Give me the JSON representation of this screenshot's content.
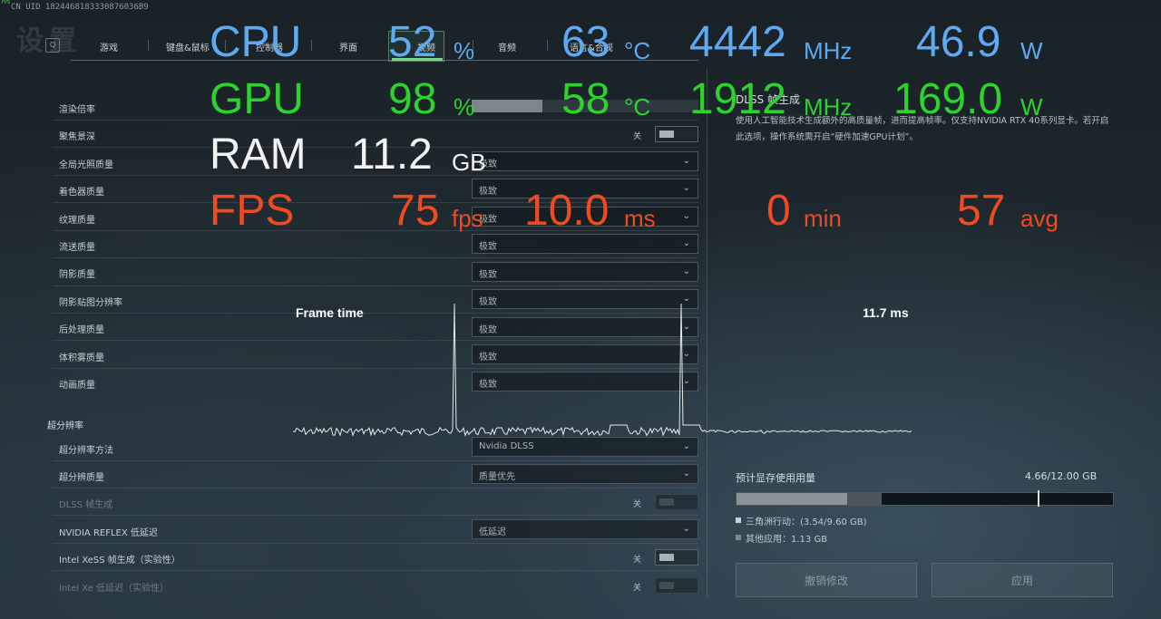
{
  "topbar": {
    "uid": "CN UID 1824468183330876036B9",
    "fps_tiny": "FPS",
    "bg_title": "设置"
  },
  "tabs": [
    {
      "label": "游戏"
    },
    {
      "label": "键盘&鼠标"
    },
    {
      "label": "控制器"
    },
    {
      "label": "界面"
    },
    {
      "label": "视频"
    },
    {
      "label": "音频"
    },
    {
      "label": "语言&合规"
    }
  ],
  "tab_q": "Q",
  "settings": {
    "rows": [
      {
        "label": "渲染倍率",
        "type": "slider"
      },
      {
        "label": "聚焦景深",
        "type": "toggle",
        "value": "关"
      },
      {
        "label": "全局光照质量",
        "type": "dropdown",
        "value": "极致"
      },
      {
        "label": "着色器质量",
        "type": "dropdown",
        "value": "极致"
      },
      {
        "label": "纹理质量",
        "type": "dropdown",
        "value": "极致"
      },
      {
        "label": "流送质量",
        "type": "dropdown",
        "value": "极致"
      },
      {
        "label": "阴影质量",
        "type": "dropdown",
        "value": "极致"
      },
      {
        "label": "阴影贴图分辨率",
        "type": "dropdown",
        "value": "极致"
      },
      {
        "label": "后处理质量",
        "type": "dropdown",
        "value": "极致"
      },
      {
        "label": "体积雾质量",
        "type": "dropdown",
        "value": "极致"
      },
      {
        "label": "动画质量",
        "type": "dropdown",
        "value": "极致"
      }
    ],
    "section_title": "超分辨率",
    "rows2": [
      {
        "label": "超分辨率方法",
        "type": "dropdown",
        "value": "Nvidia DLSS"
      },
      {
        "label": "超分辨质量",
        "type": "dropdown",
        "value": "质量优先"
      },
      {
        "label": "DLSS 帧生成",
        "type": "toggle",
        "value": "关",
        "dim": true
      },
      {
        "label": "NVIDIA REFLEX 低延迟",
        "type": "dropdown",
        "value": "低延迟"
      },
      {
        "label": "Intel XeSS 帧生成（实验性）",
        "type": "toggle",
        "value": "关"
      },
      {
        "label": "Intel Xe 低延迟（实验性）",
        "type": "toggle",
        "value": "关",
        "dim": true
      }
    ]
  },
  "details": {
    "title": "DLSS 帧生成",
    "description": "使用人工智能技术生成额外的高质量帧，进而提高帧率。仅支持NVIDIA RTX 40系列显卡。若开启此选项，操作系统需开启“硬件加速GPU计划”。"
  },
  "vram": {
    "label": "预计显存使用用量",
    "value": "4.66/12.00 GB",
    "game_label": "三角洲行动：(3.54/9.60 GB)",
    "other_label": "其他应用：1.13 GB",
    "game_fraction": 0.295,
    "other_fraction": 0.094,
    "limit_fraction": 0.8
  },
  "buttons": {
    "revert": "撤销修改",
    "apply": "应用"
  },
  "osd": {
    "cpu": {
      "label": "CPU",
      "load": "52",
      "load_unit": "%",
      "temp": "63",
      "temp_unit": "°C",
      "clock": "4442",
      "clock_unit": "MHz",
      "power": "46.9",
      "power_unit": "W"
    },
    "gpu": {
      "label": "GPU",
      "load": "98",
      "load_unit": "%",
      "temp": "58",
      "temp_unit": "°C",
      "clock": "1912",
      "clock_unit": "MHz",
      "power": "169.0",
      "power_unit": "W"
    },
    "ram": {
      "label": "RAM",
      "value": "11.2",
      "unit": "GB"
    },
    "fps": {
      "label": "FPS",
      "value": "75",
      "value_unit": "fps",
      "frametime": "10.0",
      "frametime_unit": "ms",
      "min": "0",
      "min_unit": "min",
      "avg": "57",
      "avg_unit": "avg"
    },
    "frametime_graph": {
      "title": "Frame time",
      "current": "11.7 ms"
    }
  },
  "colors": {
    "cpu": "#5fa9f2",
    "gpu": "#2fd12f",
    "ram": "#f2f2f2",
    "fps": "#f04a20",
    "accent": "#79d28e"
  }
}
